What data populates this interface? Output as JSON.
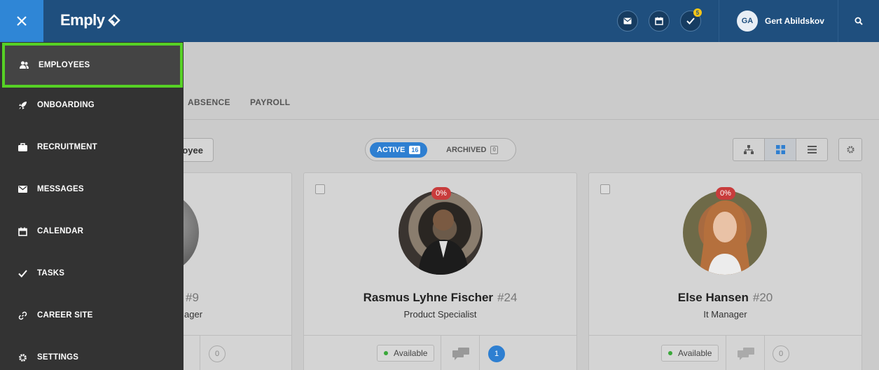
{
  "header": {
    "logo_text": "Emply",
    "task_badge": "5",
    "user_initials": "GA",
    "user_name": "Gert Abildskov"
  },
  "subnav": {
    "tabs": [
      "ABSENCE",
      "PAYROLL"
    ]
  },
  "toolbar": {
    "add_label": "oyee",
    "active_label": "ACTIVE",
    "active_count": "16",
    "archived_label": "ARCHIVED",
    "archived_count": "0"
  },
  "sidebar": {
    "items": [
      {
        "label": "EMPLOYEES",
        "icon": "users-icon"
      },
      {
        "label": "ONBOARDING",
        "icon": "rocket-icon"
      },
      {
        "label": "RECRUITMENT",
        "icon": "briefcase-icon"
      },
      {
        "label": "MESSAGES",
        "icon": "envelope-icon"
      },
      {
        "label": "CALENDAR",
        "icon": "calendar-icon"
      },
      {
        "label": "TASKS",
        "icon": "check-icon"
      },
      {
        "label": "CAREER SITE",
        "icon": "link-icon"
      },
      {
        "label": "SETTINGS",
        "icon": "gear-icon"
      }
    ]
  },
  "cards": [
    {
      "name": "",
      "number": "#9",
      "title": "ager",
      "count": "0"
    },
    {
      "name": "Rasmus Lyhne Fischer",
      "number": "#24",
      "title": "Product Specialist",
      "percent": "0%",
      "status": "Available",
      "count": "1"
    },
    {
      "name": "Else Hansen",
      "number": "#20",
      "title": "It Manager",
      "percent": "0%",
      "status": "Available",
      "count": "0"
    }
  ],
  "colors": {
    "topbar": "#1f4f7e",
    "accent": "#2e7fd1",
    "sidebar": "#333333",
    "highlight": "#56d125"
  }
}
